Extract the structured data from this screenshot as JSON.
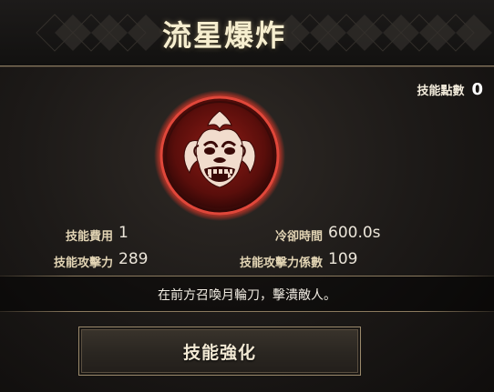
{
  "skill": {
    "title": "流星爆炸",
    "icon": "oni-demon-mask-icon"
  },
  "points": {
    "label": "技能點數",
    "value": "0"
  },
  "stats": {
    "cost_label": "技能費用",
    "cost_value": "1",
    "cooldown_label": "冷卻時間",
    "cooldown_value": "600.0s",
    "attack_label": "技能攻擊力",
    "attack_value": "289",
    "coef_label": "技能攻擊力係數",
    "coef_value": "109"
  },
  "description": "在前方召喚月輪刀，擊潰敵人。",
  "button": {
    "enhance_label": "技能強化"
  },
  "colors": {
    "accent_red": "#c0241c",
    "gold_border": "#8b7a5e"
  }
}
